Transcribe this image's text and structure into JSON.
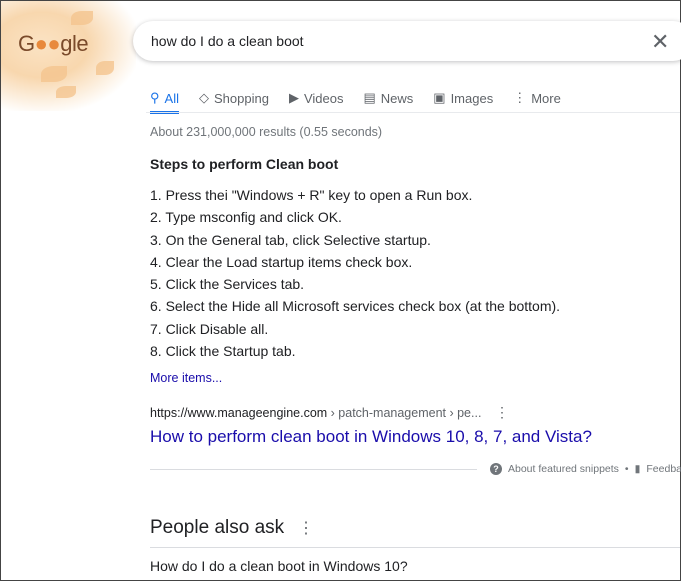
{
  "logo": "Google",
  "search": {
    "query": "how do I do a clean boot",
    "clear_icon": "close-icon"
  },
  "tabs": [
    {
      "label": "All",
      "icon": "search-icon"
    },
    {
      "label": "Shopping",
      "icon": "tag-icon"
    },
    {
      "label": "Videos",
      "icon": "play-icon"
    },
    {
      "label": "News",
      "icon": "news-icon"
    },
    {
      "label": "Images",
      "icon": "image-icon"
    },
    {
      "label": "More",
      "icon": "more-vert-icon"
    }
  ],
  "stats": "About 231,000,000 results (0.55 seconds)",
  "snippet": {
    "title": "Steps to perform Clean boot",
    "steps": [
      "1. Press thei \"Windows + R\" key to open a Run box.",
      "2. Type msconfig and click OK.",
      "3. On the General tab, click Selective startup.",
      "4. Clear the Load startup items check box.",
      "5. Click the Services tab.",
      "6. Select the Hide all Microsoft services check box (at the bottom).",
      "7. Click Disable all.",
      "8. Click the Startup tab."
    ],
    "more": "More items...",
    "url_host": "https://www.manageengine.com",
    "url_path": " › patch-management › pe...",
    "link": "How to perform clean boot in Windows 10, 8, 7, and Vista?",
    "about": "About featured snippets",
    "feedback": "Feedback"
  },
  "paa": {
    "title": "People also ask",
    "questions": [
      "How do I do a clean boot in Windows 10?"
    ]
  }
}
